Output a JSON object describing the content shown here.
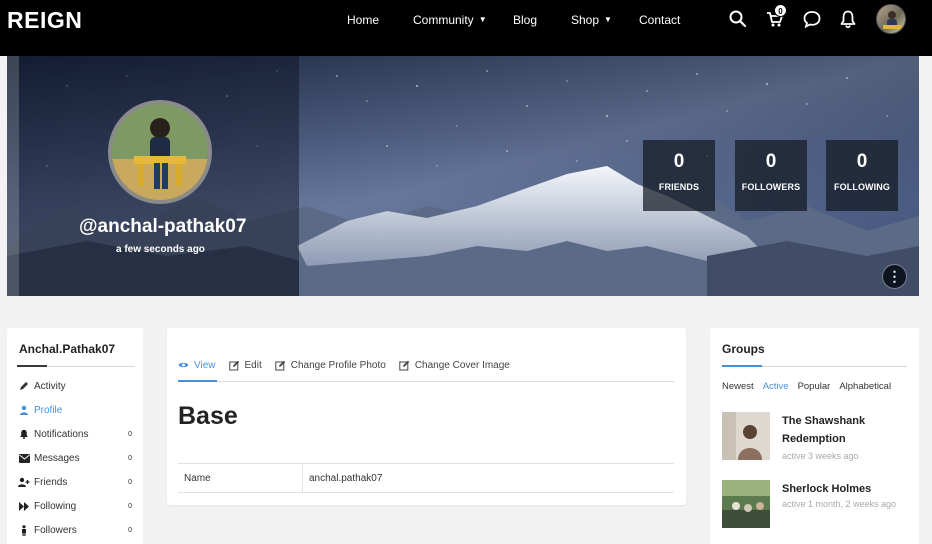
{
  "header": {
    "logo": "REIGN",
    "nav": [
      {
        "label": "Home",
        "has_caret": false
      },
      {
        "label": "Community",
        "has_caret": true
      },
      {
        "label": "Blog",
        "has_caret": false
      },
      {
        "label": "Shop",
        "has_caret": true
      },
      {
        "label": "Contact",
        "has_caret": false
      }
    ],
    "cart_count": "0",
    "icons": [
      "search-icon",
      "cart-icon",
      "chat-icon",
      "bell-icon",
      "user-avatar"
    ]
  },
  "profile": {
    "handle": "@anchal-pathak07",
    "last_active": "a few seconds ago",
    "stats": [
      {
        "value": "0",
        "label": "FRIENDS"
      },
      {
        "value": "0",
        "label": "FOLLOWERS"
      },
      {
        "value": "0",
        "label": "FOLLOWING"
      }
    ],
    "more_icon": "more-options-icon"
  },
  "sidebar": {
    "title": "Anchal.Pathak07",
    "items": [
      {
        "label": "Activity",
        "icon": "pencil-icon",
        "count": ""
      },
      {
        "label": "Profile",
        "icon": "user-icon",
        "count": "",
        "active": true
      },
      {
        "label": "Notifications",
        "icon": "bell-icon",
        "count": "0"
      },
      {
        "label": "Messages",
        "icon": "envelope-icon",
        "count": "0"
      },
      {
        "label": "Friends",
        "icon": "user-plus-icon",
        "count": "0"
      },
      {
        "label": "Following",
        "icon": "forward-icon",
        "count": "0"
      },
      {
        "label": "Followers",
        "icon": "person-icon",
        "count": "0"
      }
    ]
  },
  "main": {
    "tabs": [
      {
        "label": "View",
        "icon": "eye-icon",
        "active": true
      },
      {
        "label": "Edit",
        "icon": "edit-icon"
      },
      {
        "label": "Change Profile Photo",
        "icon": "edit-icon"
      },
      {
        "label": "Change Cover Image",
        "icon": "edit-icon"
      }
    ],
    "section_title": "Base",
    "fields": [
      {
        "key": "Name",
        "value": "anchal.pathak07"
      }
    ]
  },
  "groups": {
    "title": "Groups",
    "filters": [
      {
        "label": "Newest",
        "active": false
      },
      {
        "label": "Active",
        "active": true
      },
      {
        "label": "Popular",
        "active": false
      },
      {
        "label": "Alphabetical",
        "active": false
      }
    ],
    "items": [
      {
        "name": "The Shawshank Redemption",
        "meta": "active 3 weeks ago"
      },
      {
        "name": "Sherlock Holmes",
        "meta": "active 1 month, 2 weeks ago"
      }
    ]
  },
  "colors": {
    "accent": "#4a90d9",
    "topbar": "#000000",
    "page_bg": "#f2f2f2"
  }
}
